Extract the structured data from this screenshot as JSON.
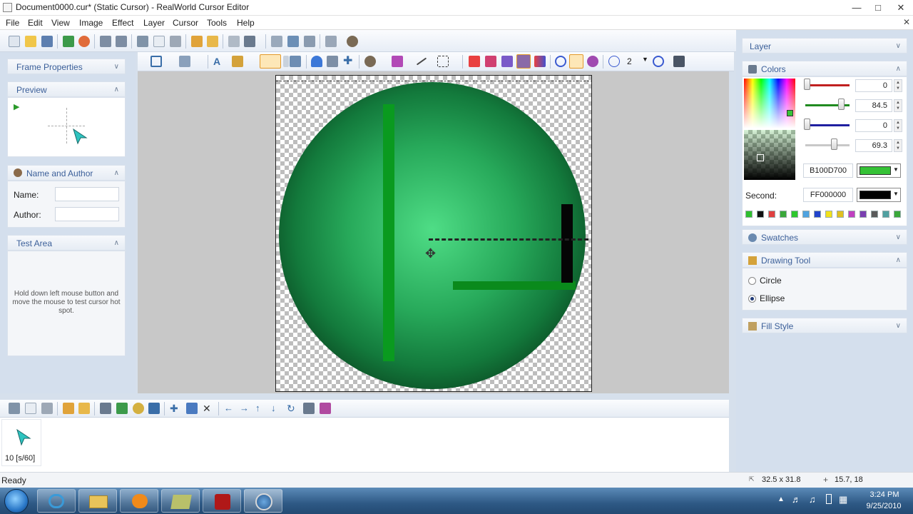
{
  "window": {
    "title": "Document0000.cur* (Static Cursor) - RealWorld Cursor Editor"
  },
  "menu": [
    "File",
    "Edit",
    "View",
    "Image",
    "Effect",
    "Layer",
    "Cursor",
    "Tools",
    "Help"
  ],
  "left_panels": {
    "frame_properties": "Frame Properties",
    "preview": "Preview",
    "name_author": {
      "title": "Name and Author",
      "name_label": "Name:",
      "author_label": "Author:",
      "name_value": "",
      "author_value": ""
    },
    "test_area": {
      "title": "Test Area",
      "hint": "Hold down left mouse button and move the mouse to test cursor hot spot."
    }
  },
  "toolbar2": {
    "brush_size": "2"
  },
  "frames": {
    "label": "10 [s/60]"
  },
  "status": {
    "text": "Ready",
    "size": "32.5 x 31.8",
    "pos": "15.7, 18"
  },
  "right_panels": {
    "layer": "Layer",
    "colors": {
      "title": "Colors",
      "values": [
        "0",
        "84.5",
        "0",
        "69.3"
      ],
      "primary_hex": "B100D700",
      "second_label": "Second:",
      "second_hex": "FF000000",
      "primary_color": "#36c236",
      "second_color": "#000000"
    },
    "palette": [
      "#2fbf2f",
      "#111111",
      "#e04040",
      "#3aa83a",
      "#2ec82e",
      "#4fa3e0",
      "#2244cc",
      "#f2e21a",
      "#e0c020",
      "#c040c0",
      "#7a3fb0",
      "#5a5a5a",
      "#50a0a0",
      "#3aa83a"
    ],
    "swatches": "Swatches",
    "drawing_tool": {
      "title": "Drawing Tool",
      "options": [
        "Circle",
        "Ellipse"
      ],
      "selected": "Ellipse"
    },
    "fill_style": "Fill Style"
  },
  "taskbar": {
    "time": "3:24 PM",
    "date": "9/25/2010"
  }
}
